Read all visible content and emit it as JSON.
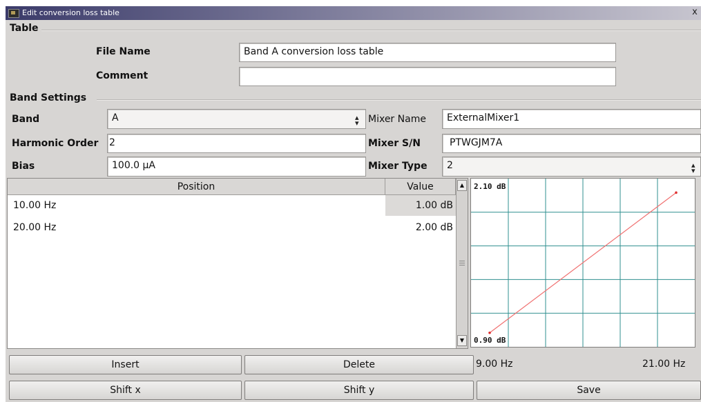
{
  "window": {
    "title": "Edit conversion loss table",
    "close_label": "x"
  },
  "table_section": {
    "label": "Table",
    "file_name_label": "File Name",
    "file_name_value": "Band A conversion loss table",
    "comment_label": "Comment",
    "comment_value": ""
  },
  "band_section": {
    "label": "Band Settings",
    "band_label": "Band",
    "band_value": "A",
    "harmonic_label": "Harmonic Order",
    "harmonic_value": "2",
    "bias_label": "Bias",
    "bias_value": "100.0 µA",
    "mixer_name_label": "Mixer Name",
    "mixer_name_value": "ExternalMixer1",
    "mixer_sn_label": "Mixer S/N",
    "mixer_sn_value": "PTWGJM7A",
    "mixer_type_label": "Mixer Type",
    "mixer_type_value": "2"
  },
  "table": {
    "headers": {
      "position": "Position",
      "value": "Value"
    },
    "rows": [
      {
        "position": "10.00 Hz",
        "value": "1.00 dB"
      },
      {
        "position": "20.00 Hz",
        "value": "2.00 dB"
      }
    ]
  },
  "chart_data": {
    "type": "line",
    "series": [
      {
        "x": [
          10,
          20
        ],
        "y": [
          1.0,
          2.0
        ]
      }
    ],
    "x_min_label": "9.00 Hz",
    "x_max_label": "21.00 Hz",
    "y_min_label": "0.90 dB",
    "y_max_label": "2.10 dB",
    "xlim": [
      9,
      21
    ],
    "ylim": [
      0.9,
      2.1
    ],
    "line_color": "#f07070",
    "grid_color": "#2f8f8f",
    "grid": true
  },
  "buttons": {
    "insert": "Insert",
    "delete": "Delete",
    "shift_x": "Shift x",
    "shift_y": "Shift y",
    "save": "Save"
  }
}
